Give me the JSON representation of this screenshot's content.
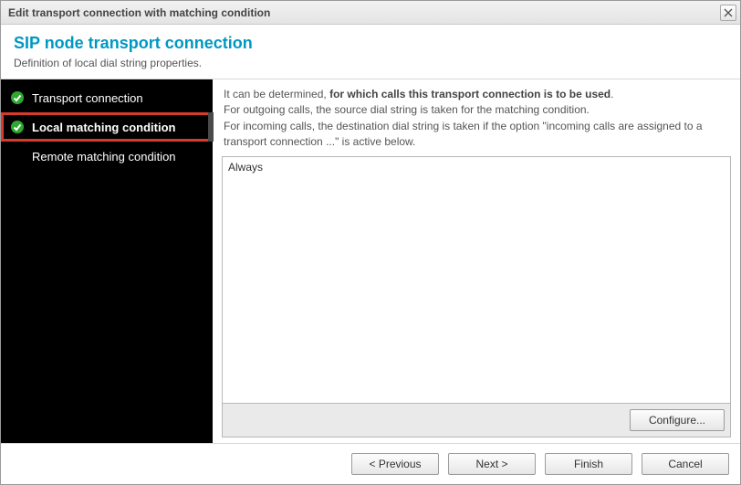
{
  "window": {
    "title": "Edit transport connection with matching condition"
  },
  "header": {
    "title": "SIP node transport connection",
    "subtitle": "Definition of local dial string properties."
  },
  "sidebar": {
    "steps": [
      {
        "label": "Transport connection"
      },
      {
        "label": "Local matching condition"
      },
      {
        "label": "Remote matching condition"
      }
    ]
  },
  "main": {
    "info_prefix": "It can be determined, ",
    "info_bold": "for which calls this transport connection is to be used",
    "info_suffix": ".",
    "info_line2": "For outgoing calls, the source dial string is taken for the matching condition.",
    "info_line3": "For incoming calls, the destination dial string is taken if the option \"incoming calls are assigned to a transport connection ...\" is active below.",
    "list_value": "Always",
    "configure_label": "Configure..."
  },
  "footer": {
    "previous": "< Previous",
    "next": "Next >",
    "finish": "Finish",
    "cancel": "Cancel"
  }
}
